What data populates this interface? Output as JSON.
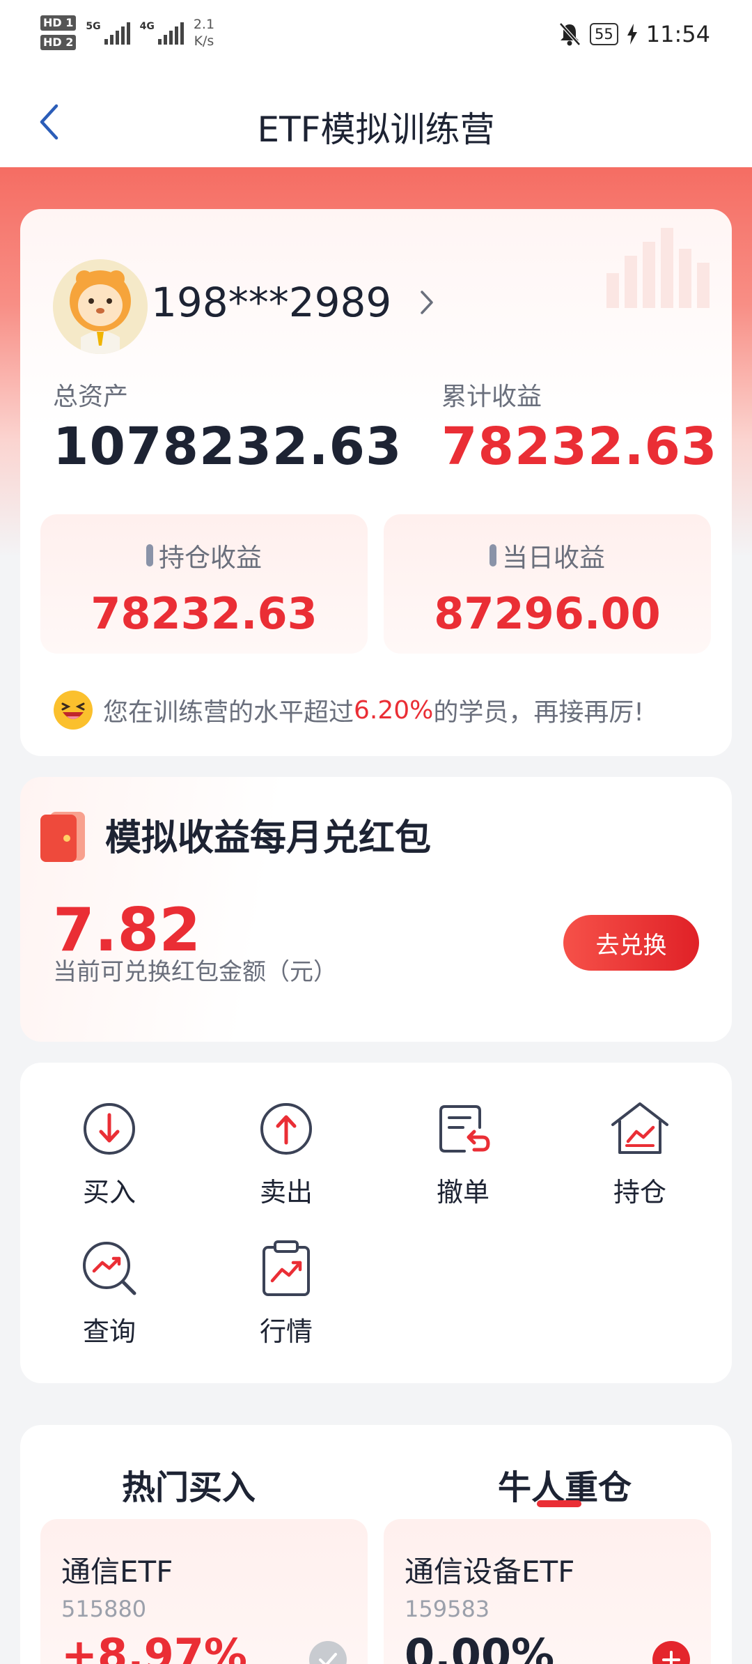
{
  "status_bar": {
    "hd1": "HD 1",
    "hd2": "HD 2",
    "net1": "5G",
    "net2": "4G",
    "speed_value": "2.1",
    "speed_unit": "K/s",
    "battery": "55",
    "time": "11:54"
  },
  "nav": {
    "title": "ETF模拟训练营",
    "back_icon": "chevron-left-icon"
  },
  "account": {
    "user_id": "198***2989",
    "total_assets_label": "总资产",
    "total_assets": "1078232.63",
    "cumulative_profit_label": "累计收益",
    "cumulative_profit": "78232.63",
    "holding_profit_label": "持仓收益",
    "holding_profit": "78232.63",
    "daily_profit_label": "当日收益",
    "daily_profit": "87296.00",
    "tip_prefix": "您在训练营的水平超过",
    "tip_percent": "6.20%",
    "tip_suffix": "的学员，再接再厉!",
    "colors": {
      "profit": "#ea2e35",
      "text": "#1d2333"
    }
  },
  "red_packet": {
    "title": "模拟收益每月兑红包",
    "amount": "7.82",
    "amount_label": "当前可兑换红包金额（元）",
    "button": "去兑换"
  },
  "functions": [
    {
      "label": "买入",
      "icon": "buy-arrow-down-icon"
    },
    {
      "label": "卖出",
      "icon": "sell-arrow-up-icon"
    },
    {
      "label": "撤单",
      "icon": "cancel-order-icon"
    },
    {
      "label": "持仓",
      "icon": "holdings-house-icon"
    },
    {
      "label": "查询",
      "icon": "query-search-icon"
    },
    {
      "label": "行情",
      "icon": "market-clipboard-icon"
    }
  ],
  "lists": {
    "tabs": [
      "热门买入",
      "牛人重仓"
    ],
    "active_tab": 1,
    "items": [
      {
        "name": "通信ETF",
        "code": "515880",
        "change": "+8.97%",
        "change_color": "#ea2e35",
        "action_icon": "check-circle-icon"
      },
      {
        "name": "通信设备ETF",
        "code": "159583",
        "change": "0.00%",
        "change_color": "#1d2333",
        "action_icon": "add-circle-icon"
      }
    ]
  }
}
